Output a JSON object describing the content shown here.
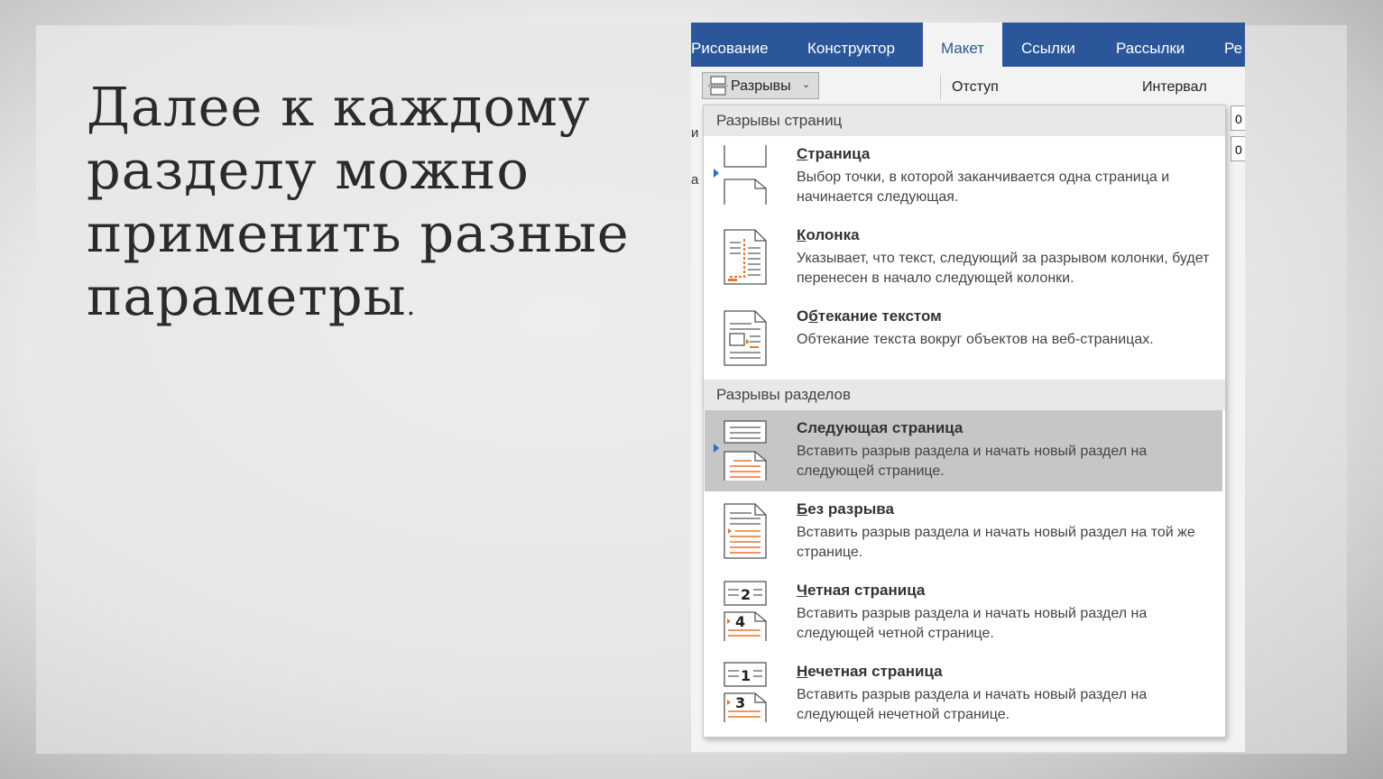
{
  "slide": {
    "text_lines": [
      "Далее к каждому",
      "разделу можно",
      "применить разные",
      "параметры"
    ],
    "text_end": "."
  },
  "ribbon": {
    "tabs": [
      {
        "label": "Рисование"
      },
      {
        "label": "Конструктор"
      },
      {
        "label": "Макет",
        "active": true
      },
      {
        "label": "Ссылки"
      },
      {
        "label": "Рассылки"
      },
      {
        "label": "Ре"
      }
    ],
    "breaks_button": "Разрывы",
    "indent_label": "Отступ",
    "spacing_label": "Интервал",
    "spin_values": [
      "0",
      "0"
    ],
    "left_fragments": [
      "и",
      "а"
    ]
  },
  "menu": {
    "page_breaks_header": "Разрывы страниц",
    "section_breaks_header": "Разрывы разделов",
    "items": [
      {
        "title": "Страница",
        "mnemonic": "С",
        "description": "Выбор точки, в которой заканчивается одна страница и начинается следующая.",
        "icon": "page-break-icon"
      },
      {
        "title": "Колонка",
        "mnemonic": "К",
        "description": "Указывает, что текст, следующий за разрывом колонки, будет перенесен в начало следующей колонки.",
        "icon": "column-break-icon"
      },
      {
        "title": "Обтекание текстом",
        "mnemonic": "б",
        "description": "Обтекание текста вокруг объектов на веб-страницах.",
        "icon": "text-wrapping-icon"
      },
      {
        "title": "Следующая страница",
        "mnemonic": "",
        "description": "Вставить разрыв раздела и начать новый раздел на следующей странице.",
        "icon": "next-page-icon",
        "highlighted": true
      },
      {
        "title": "Без разрыва",
        "mnemonic": "Б",
        "description": "Вставить разрыв раздела и начать новый раздел на той же странице.",
        "icon": "continuous-icon"
      },
      {
        "title": "Четная страница",
        "mnemonic": "Ч",
        "description": "Вставить разрыв раздела и начать новый раздел на следующей четной странице.",
        "icon": "even-page-icon",
        "badge_top": "2",
        "badge_bottom": "4"
      },
      {
        "title": "Нечетная страница",
        "mnemonic": "Н",
        "description": "Вставить разрыв раздела и начать новый раздел на следующей нечетной странице.",
        "icon": "odd-page-icon",
        "badge_top": "1",
        "badge_bottom": "3"
      }
    ]
  },
  "colors": {
    "ribbon": "#2b579a",
    "accent_orange": "#e8742c",
    "highlight": "#c6c6c6"
  }
}
